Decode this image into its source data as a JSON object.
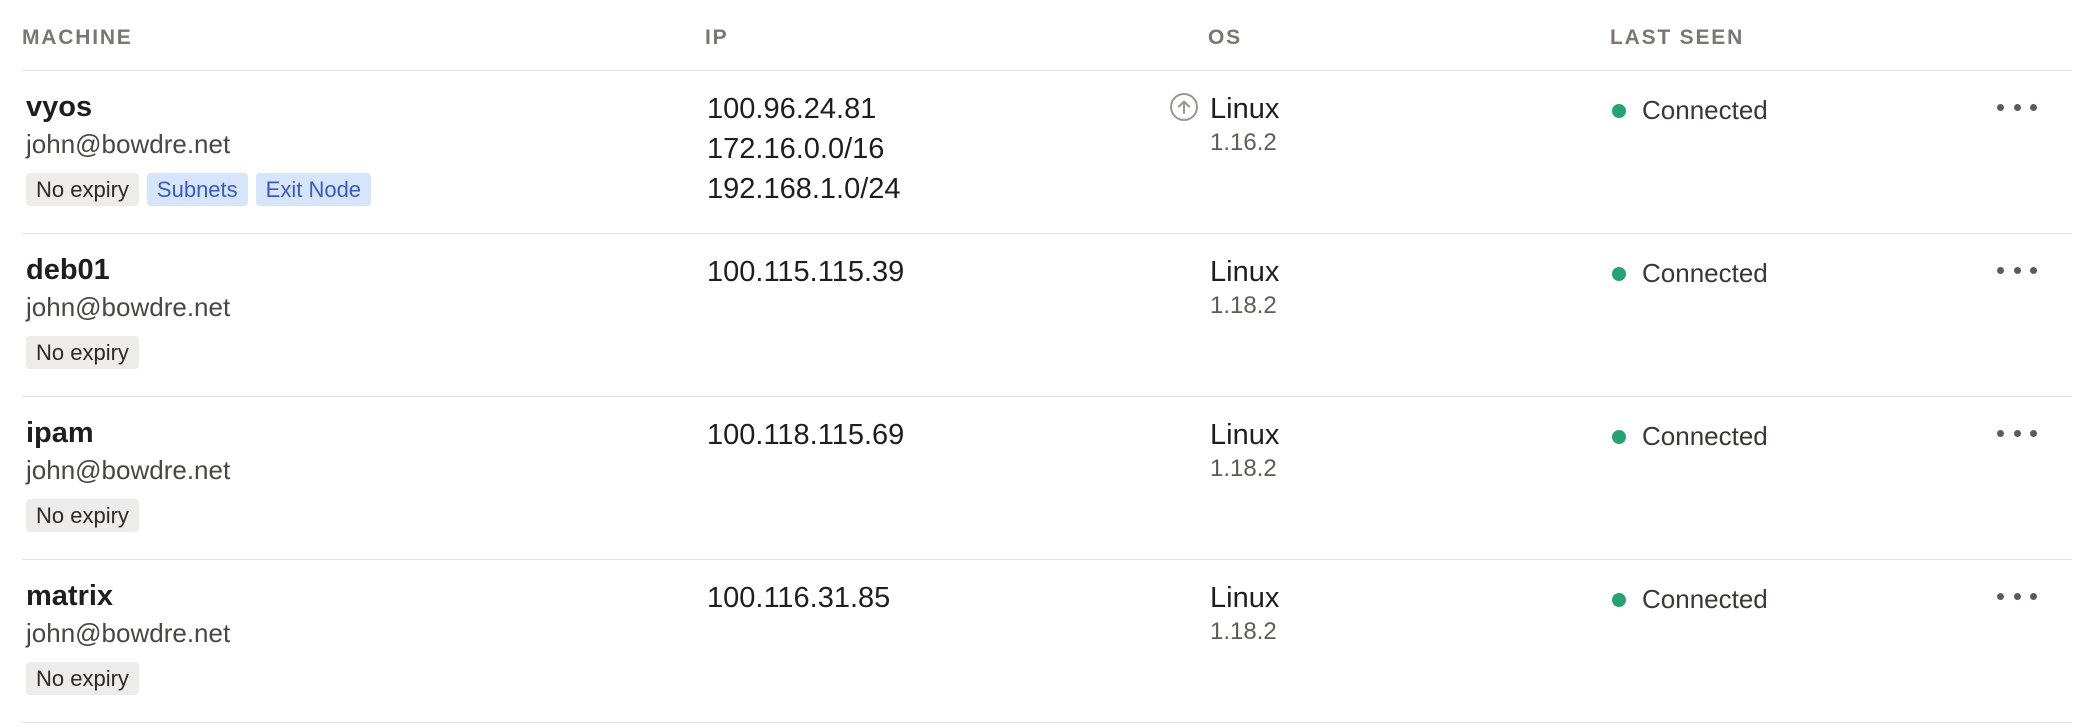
{
  "columns": {
    "machine": "MACHINE",
    "ip": "IP",
    "os": "OS",
    "last_seen": "LAST SEEN"
  },
  "colors": {
    "connected": "#25a373",
    "tag_gray": "#eeecea",
    "tag_blue": "#d6e4fc"
  },
  "machines": [
    {
      "name": "vyos",
      "owner": "john@bowdre.net",
      "tags": [
        "No expiry",
        "Subnets",
        "Exit Node"
      ],
      "ips": [
        "100.96.24.81",
        "172.16.0.0/16",
        "192.168.1.0/24"
      ],
      "update_icon": "arrow-up-circle-icon",
      "os": "Linux",
      "version": "1.16.2",
      "status": "Connected"
    },
    {
      "name": "deb01",
      "owner": "john@bowdre.net",
      "tags": [
        "No expiry"
      ],
      "ips": [
        "100.115.115.39"
      ],
      "os": "Linux",
      "version": "1.18.2",
      "status": "Connected"
    },
    {
      "name": "ipam",
      "owner": "john@bowdre.net",
      "tags": [
        "No expiry"
      ],
      "ips": [
        "100.118.115.69"
      ],
      "os": "Linux",
      "version": "1.18.2",
      "status": "Connected"
    },
    {
      "name": "matrix",
      "owner": "john@bowdre.net",
      "tags": [
        "No expiry"
      ],
      "ips": [
        "100.116.31.85"
      ],
      "os": "Linux",
      "version": "1.18.2",
      "status": "Connected"
    }
  ]
}
